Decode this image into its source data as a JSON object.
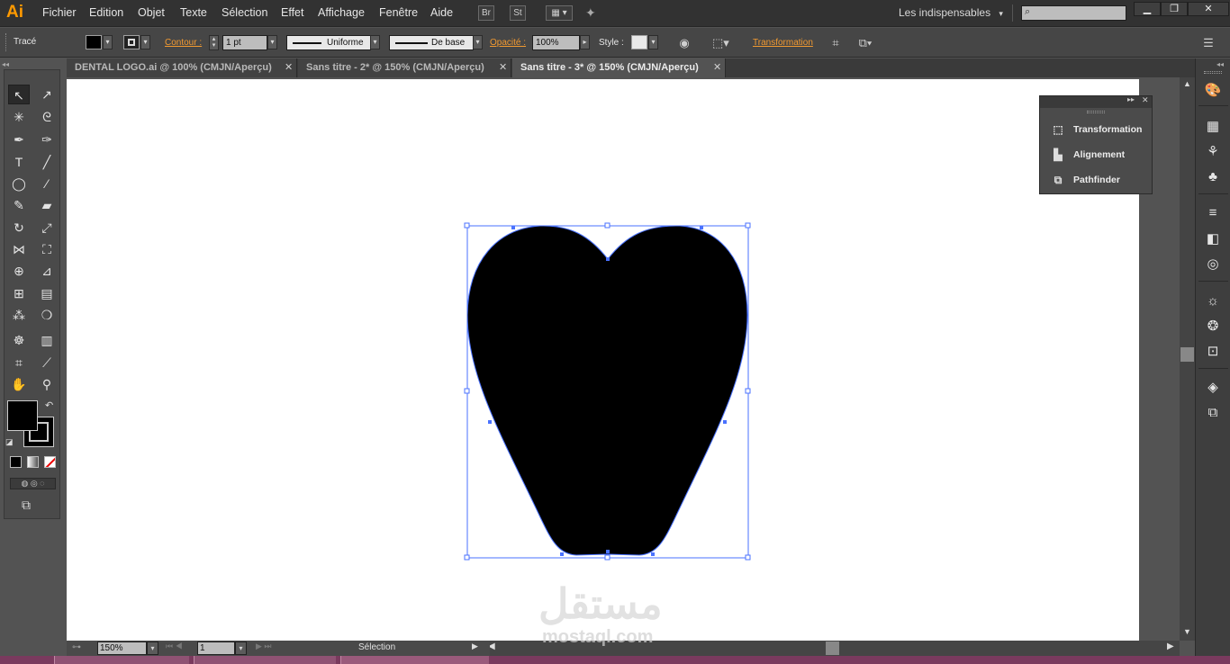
{
  "app": {
    "logo": "Ai",
    "workspace": "Les indispensables"
  },
  "menu": [
    "Fichier",
    "Edition",
    "Objet",
    "Texte",
    "Sélection",
    "Effet",
    "Affichage",
    "Fenêtre",
    "Aide"
  ],
  "app_buttons": {
    "bridge": "Br",
    "stock": "St"
  },
  "control": {
    "object_type": "Tracé",
    "contour_label": "Contour :",
    "stroke_weight": "1 pt",
    "profile": "Uniforme",
    "brush": "De base",
    "opacity_label": "Opacité :",
    "opacity_value": "100%",
    "style_label": "Style :",
    "transform_label": "Transformation"
  },
  "tabs": [
    {
      "label": "DENTAL LOGO.ai @ 100% (CMJN/Aperçu)",
      "active": false
    },
    {
      "label": "Sans titre - 2* @ 150% (CMJN/Aperçu)",
      "active": false
    },
    {
      "label": "Sans titre - 3* @ 150% (CMJN/Aperçu)",
      "active": true
    }
  ],
  "panel": {
    "items": [
      "Transformation",
      "Alignement",
      "Pathfinder"
    ]
  },
  "status": {
    "zoom": "150%",
    "artboard": "1",
    "tool": "Sélection"
  },
  "watermark": {
    "main": "مستقل",
    "sub": "mostaql.com"
  },
  "colors": {
    "accent": "#f29a31",
    "selection": "#4a72ff",
    "fill": "#000000",
    "taskbar": "#7a3a5e"
  }
}
